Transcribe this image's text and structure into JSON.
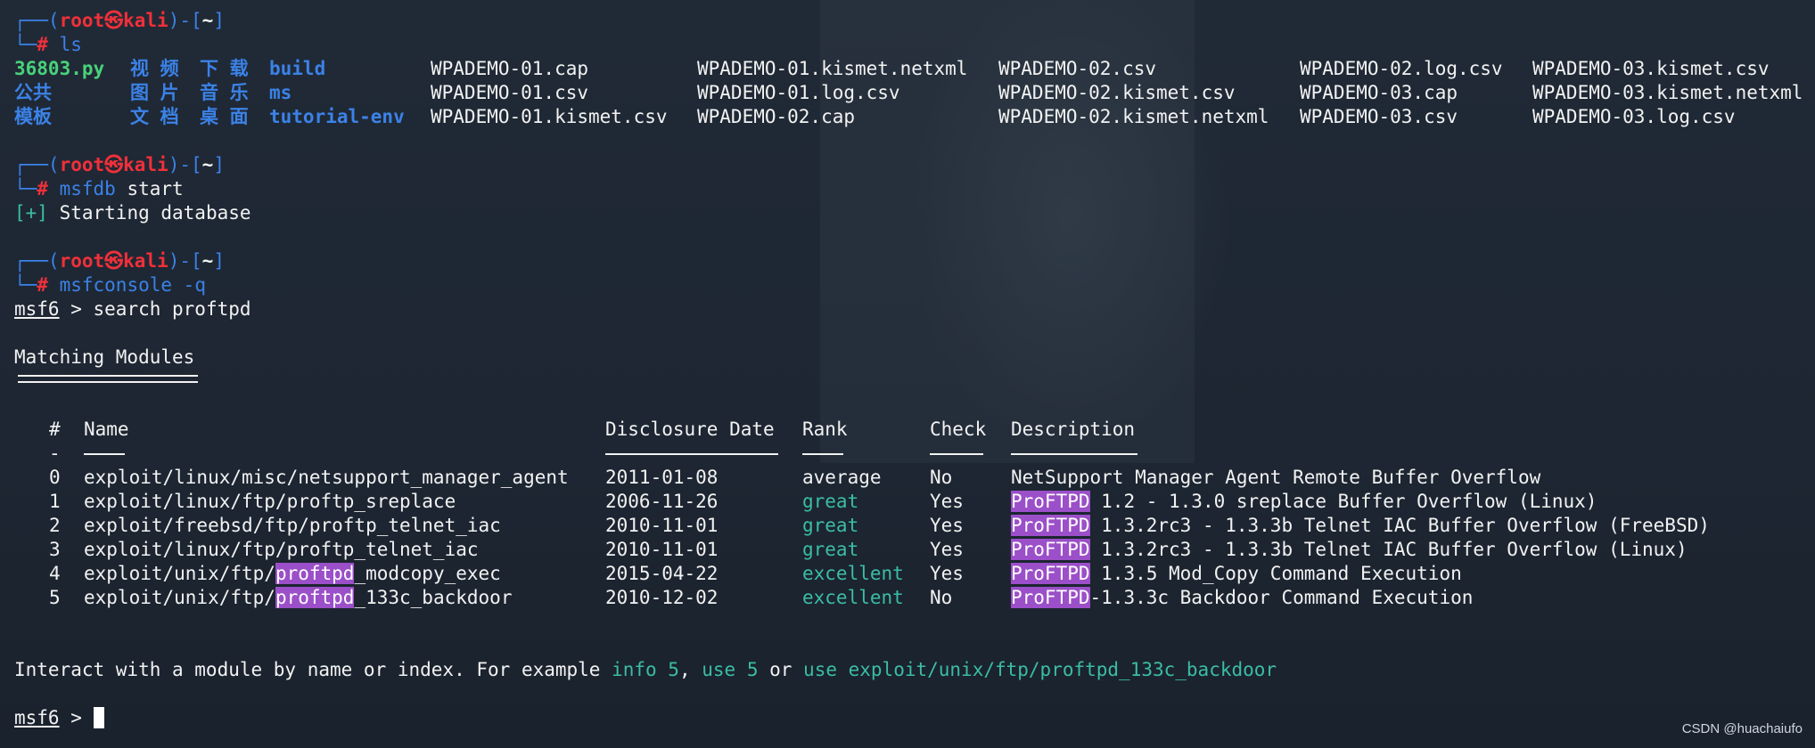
{
  "prompt": {
    "open": "┌──(",
    "user": "root㉿kali",
    "mid": ")-[",
    "dir": "~",
    "close": "]",
    "hook": "└─",
    "hash": "# "
  },
  "session": [
    {
      "command_name": "ls",
      "command_args": ""
    },
    {
      "command_name": "msfdb",
      "command_args": " start"
    },
    {
      "command_name": "msfconsole",
      "command_args": " -q"
    }
  ],
  "ls_output": {
    "rows": [
      [
        {
          "text": "36803.py",
          "kind": "exe"
        },
        {
          "text": "视 频",
          "kind": "dir"
        },
        {
          "text": "下 载",
          "kind": "dir"
        },
        {
          "text": "build",
          "kind": "dir"
        },
        {
          "text": "WPADEMO-01.cap",
          "kind": "file"
        },
        {
          "text": "WPADEMO-01.kismet.netxml",
          "kind": "file"
        },
        {
          "text": "WPADEMO-02.csv",
          "kind": "file"
        },
        {
          "text": "WPADEMO-02.log.csv",
          "kind": "file"
        },
        {
          "text": "WPADEMO-03.kismet.csv",
          "kind": "file"
        }
      ],
      [
        {
          "text": "公共",
          "kind": "dir"
        },
        {
          "text": "图 片",
          "kind": "dir"
        },
        {
          "text": "音 乐",
          "kind": "dir"
        },
        {
          "text": "ms",
          "kind": "dir"
        },
        {
          "text": "WPADEMO-01.csv",
          "kind": "file"
        },
        {
          "text": "WPADEMO-01.log.csv",
          "kind": "file"
        },
        {
          "text": "WPADEMO-02.kismet.csv",
          "kind": "file"
        },
        {
          "text": "WPADEMO-03.cap",
          "kind": "file"
        },
        {
          "text": "WPADEMO-03.kismet.netxml",
          "kind": "file"
        }
      ],
      [
        {
          "text": "模板",
          "kind": "dir"
        },
        {
          "text": "文 档",
          "kind": "dir"
        },
        {
          "text": "桌 面",
          "kind": "dir"
        },
        {
          "text": "tutorial-env",
          "kind": "dir"
        },
        {
          "text": "WPADEMO-01.kismet.csv",
          "kind": "file"
        },
        {
          "text": "WPADEMO-02.cap",
          "kind": "file"
        },
        {
          "text": "WPADEMO-02.kismet.netxml",
          "kind": "file"
        },
        {
          "text": "WPADEMO-03.csv",
          "kind": "file"
        },
        {
          "text": "WPADEMO-03.log.csv",
          "kind": "file"
        }
      ]
    ]
  },
  "msfdb_output": {
    "marker": "[+]",
    "text": " Starting database"
  },
  "msf": {
    "prompt_name": "msf6",
    "prompt_sep": " > ",
    "search_command": "search proftpd",
    "heading": "Matching Modules",
    "columns": {
      "num": "#",
      "name": "Name",
      "date": "Disclosure Date",
      "rank": "Rank",
      "check": "Check",
      "desc": "Description"
    },
    "num_underline": "-",
    "modules": [
      {
        "num": "0",
        "name_pre": "exploit/linux/misc/netsupport_manager_agent",
        "name_hl": "",
        "name_post": "",
        "date": "2011-01-08",
        "rank": "average",
        "check": "No",
        "desc_hl": "",
        "desc_post": "NetSupport Manager Agent Remote Buffer Overflow"
      },
      {
        "num": "1",
        "name_pre": "exploit/linux/ftp/proftp_sreplace",
        "name_hl": "",
        "name_post": "",
        "date": "2006-11-26",
        "rank": "great",
        "check": "Yes",
        "desc_hl": "ProFTPD",
        "desc_post": " 1.2 - 1.3.0 sreplace Buffer Overflow (Linux)"
      },
      {
        "num": "2",
        "name_pre": "exploit/freebsd/ftp/proftp_telnet_iac",
        "name_hl": "",
        "name_post": "",
        "date": "2010-11-01",
        "rank": "great",
        "check": "Yes",
        "desc_hl": "ProFTPD",
        "desc_post": " 1.3.2rc3 - 1.3.3b Telnet IAC Buffer Overflow (FreeBSD)"
      },
      {
        "num": "3",
        "name_pre": "exploit/linux/ftp/proftp_telnet_iac",
        "name_hl": "",
        "name_post": "",
        "date": "2010-11-01",
        "rank": "great",
        "check": "Yes",
        "desc_hl": "ProFTPD",
        "desc_post": " 1.3.2rc3 - 1.3.3b Telnet IAC Buffer Overflow (Linux)"
      },
      {
        "num": "4",
        "name_pre": "exploit/unix/ftp/",
        "name_hl": "proftpd",
        "name_post": "_modcopy_exec",
        "date": "2015-04-22",
        "rank": "excellent",
        "check": "Yes",
        "desc_hl": "ProFTPD",
        "desc_post": " 1.3.5 Mod_Copy Command Execution"
      },
      {
        "num": "5",
        "name_pre": "exploit/unix/ftp/",
        "name_hl": "proftpd",
        "name_post": "_133c_backdoor",
        "date": "2010-12-02",
        "rank": "excellent",
        "check": "No",
        "desc_hl": "ProFTPD",
        "desc_post": "-1.3.3c Backdoor Command Execution"
      }
    ],
    "interact": {
      "lead": "Interact with a module by name or index. For example ",
      "ex1": "info 5",
      "sep1": ", ",
      "ex2": "use 5",
      "sep2": " or ",
      "ex3": "use exploit/unix/ftp/proftpd_133c_backdoor"
    }
  },
  "watermark": "CSDN @huachaiufo",
  "colors": {
    "background": "#1e2733",
    "prompt_blue": "#3b82e8",
    "prompt_red": "#f0303a",
    "rank_green": "#3bbda5",
    "highlight_purple": "#9b4fc8",
    "exe_green": "#49d17a"
  }
}
